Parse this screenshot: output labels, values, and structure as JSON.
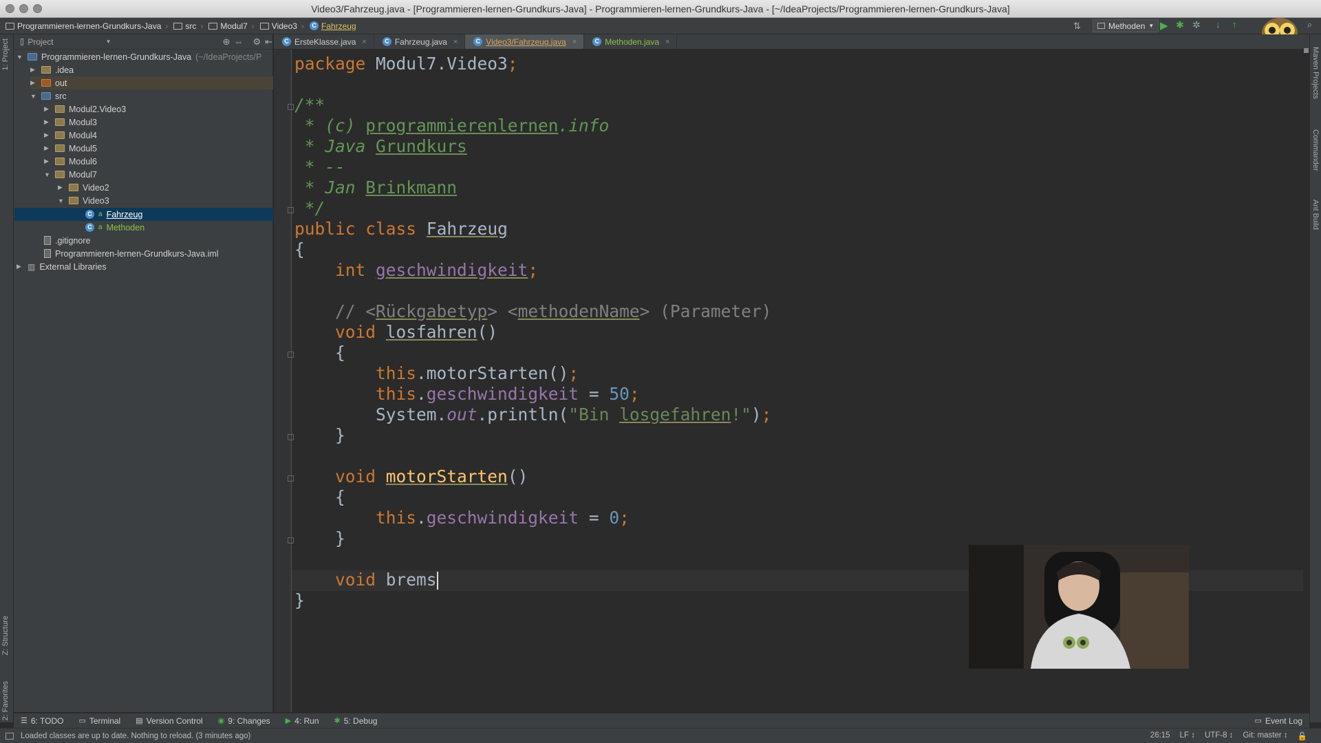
{
  "window": {
    "title": "Video3/Fahrzeug.java - [Programmieren-lernen-Grundkurs-Java] - Programmieren-lernen-Grundkurs-Java - [~/IdeaProjects/Programmieren-lernen-Grundkurs-Java]"
  },
  "navbar": {
    "crumbs": [
      "Programmieren-lernen-Grundkurs-Java",
      "src",
      "Modul7",
      "Video3",
      "Fahrzeug"
    ],
    "run_config": "Methoden"
  },
  "sidebar_left": {
    "project_label": "1: Project",
    "structure_label": "Z: Structure",
    "favorites_label": "2: Favorites"
  },
  "sidebar_right": {
    "maven_label": "Maven Projects",
    "commander_label": "Commander",
    "ant_label": "Ant Build"
  },
  "project_panel": {
    "header": "Project",
    "tree": [
      {
        "label": "Programmieren-lernen-Grundkurs-Java",
        "suffix": "(~/IdeaProjects/P"
      },
      {
        "label": ".idea"
      },
      {
        "label": "out"
      },
      {
        "label": "src"
      },
      {
        "label": "Modul2.Video3"
      },
      {
        "label": "Modul3"
      },
      {
        "label": "Modul4"
      },
      {
        "label": "Modul5"
      },
      {
        "label": "Modul6"
      },
      {
        "label": "Modul7"
      },
      {
        "label": "Video2"
      },
      {
        "label": "Video3"
      },
      {
        "label": "Fahrzeug"
      },
      {
        "label": "Methoden"
      },
      {
        "label": ".gitignore"
      },
      {
        "label": "Programmieren-lernen-Grundkurs-Java.iml"
      },
      {
        "label": "External Libraries"
      }
    ]
  },
  "tabs": [
    {
      "label": "ErsteKlasse.java"
    },
    {
      "label": "Fahrzeug.java"
    },
    {
      "label": "Video3/Fahrzeug.java"
    },
    {
      "label": "Methoden.java"
    }
  ],
  "code": {
    "pkg_kw": "package",
    "pkg_name": " Modul7.Video3",
    "semi": ";",
    "doc_open": "/**",
    "doc_c_prefix": " * (c) ",
    "doc_c_site": "programmierenlernen",
    "doc_c_tld": ".info",
    "doc_java_prefix": " * Java ",
    "doc_java_word": "Grundkurs",
    "doc_dash": " * --",
    "doc_author_prefix": " * Jan ",
    "doc_author_last": "Brinkmann",
    "doc_close": " */",
    "kw_public": "public",
    "kw_class": "class",
    "class_name": "Fahrzeug",
    "brace_open": "{",
    "brace_close": "}",
    "kw_int": "int",
    "field_name": "geschwindigkeit",
    "comment_prefix": "// <",
    "comment_rtype": "Rückgabetyp",
    "comment_mid": "> <",
    "comment_mname": "methodenName",
    "comment_suffix": "> (Parameter)",
    "kw_void": "void",
    "m1_name": "losfahren",
    "parens": "()",
    "kw_this": "this",
    "dot": ".",
    "call_motor": "motorStarten",
    "call_parens": "()",
    "assign": " = ",
    "val_50": "50",
    "val_0": "0",
    "sys": "System.",
    "out": "out",
    "println": ".println(",
    "str_open": "\"Bin ",
    "str_word": "losgefahren",
    "str_close": "!\"",
    "close_paren": ")",
    "m2_name": "motorStarten",
    "m3_partial": "brems"
  },
  "toolwindows": [
    {
      "label": "6: TODO"
    },
    {
      "label": "Terminal"
    },
    {
      "label": "Version Control"
    },
    {
      "label": "9: Changes"
    },
    {
      "label": "4: Run"
    },
    {
      "label": "5: Debug"
    }
  ],
  "event_log": "Event Log",
  "status": {
    "message": "Loaded classes are up to date. Nothing to reload. (3 minutes ago)",
    "position": "26:15",
    "line_sep": "LF ↕",
    "encoding": "UTF-8 ↕",
    "git": "Git: master ↕"
  },
  "colors": {
    "keyword": "#cc7832",
    "comment": "#629755",
    "field": "#9876aa",
    "number": "#6897bb",
    "method": "#ffc66d",
    "string": "#6a8759",
    "selection": "#0d3a58"
  }
}
